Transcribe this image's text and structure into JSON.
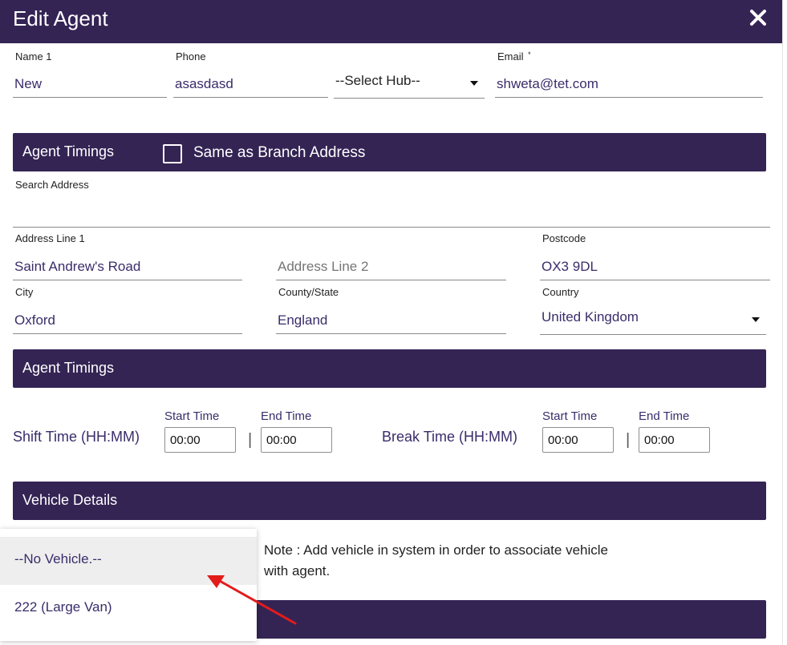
{
  "dialog": {
    "title": "Edit Agent"
  },
  "general": {
    "name_label": "Name 1",
    "name_value": "New",
    "phone_label": "Phone",
    "phone_value": "asasdasd",
    "hub_selected": "--Select Hub--",
    "email_label": "Email",
    "email_required_mark": "*",
    "email_value": "shweta@tet.com"
  },
  "address_section": {
    "bar_title": "Agent Timings",
    "same_as_branch_label": "Same as Branch Address",
    "search_address_label": "Search Address",
    "search_address_value": "",
    "address_line1_label": "Address Line 1",
    "address_line1_value": "Saint Andrew's Road",
    "address_line2_placeholder": "Address Line 2",
    "postcode_label": "Postcode",
    "postcode_value": "OX3 9DL",
    "city_label": "City",
    "city_value": "Oxford",
    "county_label": "County/State",
    "county_value": "England",
    "country_label": "Country",
    "country_value": "United Kingdom"
  },
  "timings_section": {
    "bar_title": "Agent Timings",
    "shift_label": "Shift Time (HH:MM)",
    "break_label": "Break Time (HH:MM)",
    "start_time_label": "Start Time",
    "end_time_label": "End Time",
    "separator": "|",
    "shift_start": "00:00",
    "shift_end": "00:00",
    "break_start": "00:00",
    "break_end": "00:00"
  },
  "vehicle_section": {
    "bar_title": "Vehicle Details",
    "options": [
      "--No Vehicle.--",
      "222 (Large Van)"
    ],
    "note": "Note : Add vehicle in system in order to associate vehicle with agent."
  },
  "colors": {
    "header_bg": "#342454",
    "accent_text": "#3a2d6b",
    "annotation_arrow": "#e31b1b"
  },
  "icons": {
    "close": "close-icon",
    "dropdown": "chevron-down-icon",
    "checkbox": "checkbox-icon",
    "annotation": "arrow-annotation-icon"
  }
}
